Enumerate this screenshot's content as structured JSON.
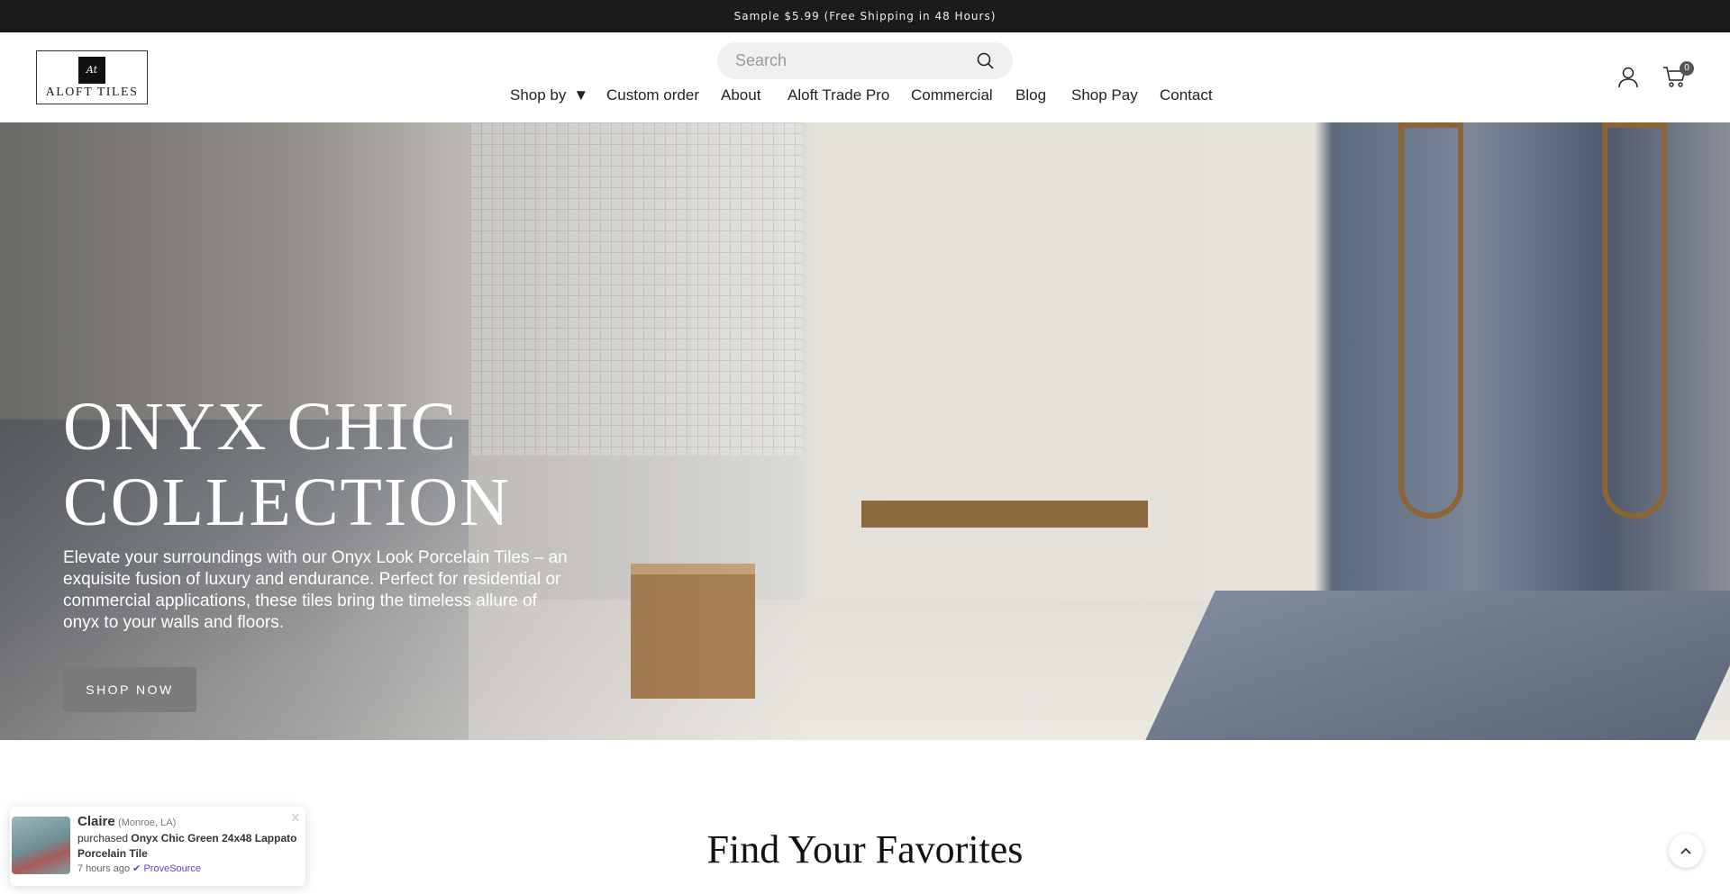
{
  "announcement": "Sample $5.99 (Free Shipping in 48 Hours)",
  "logo": {
    "name": "ALOFT TILES",
    "mark": "At"
  },
  "search": {
    "placeholder": "Search"
  },
  "nav": [
    {
      "label": "Shop by",
      "has_dropdown": true
    },
    {
      "label": "Custom order"
    },
    {
      "label": "About"
    },
    {
      "label": "Aloft Trade Pro"
    },
    {
      "label": "Commercial"
    },
    {
      "label": "Blog"
    },
    {
      "label": "Shop Pay"
    },
    {
      "label": "Contact"
    }
  ],
  "cart": {
    "count": "0"
  },
  "hero": {
    "title_line1": "ONYX CHIC",
    "title_line2": "COLLECTION",
    "description": "Elevate your surroundings with our Onyx Look Porcelain Tiles – an exquisite fusion of luxury and endurance. Perfect for residential or commercial applications, these tiles bring the timeless allure of onyx to your walls and floors.",
    "button": "SHOP NOW"
  },
  "section_title": "Find Your Favorites",
  "notification": {
    "name": "Claire",
    "location": "(Monroe, LA)",
    "action": "purchased",
    "product": "Onyx Chic Green 24x48 Lappato Porcelain Tile",
    "time": "7 hours ago",
    "source": "ProveSource",
    "close": "×"
  },
  "colors": {
    "topbar": "#1b1b1b",
    "provesource": "#6b3fd4"
  }
}
